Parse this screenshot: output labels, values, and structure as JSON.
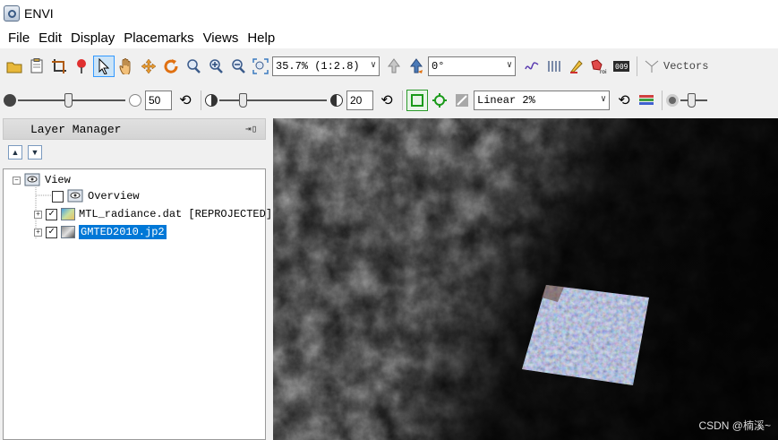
{
  "window": {
    "title": "ENVI"
  },
  "menu": [
    "File",
    "Edit",
    "Display",
    "Placemarks",
    "Views",
    "Help"
  ],
  "toolbar1": {
    "zoom_value": "35.7% (1:2.8)",
    "rotation_value": "0°",
    "vectors_label": "Vectors"
  },
  "toolbar2": {
    "brightness_value": "50",
    "contrast_value": "20",
    "stretch_value": "Linear 2%"
  },
  "layer_manager": {
    "title": "Layer Manager",
    "tree": {
      "root": "View",
      "items": [
        "Overview",
        "MTL_radiance.dat [REPROJECTED]",
        "GMTED2010.jp2"
      ]
    }
  },
  "watermark": "CSDN @楠溪~"
}
